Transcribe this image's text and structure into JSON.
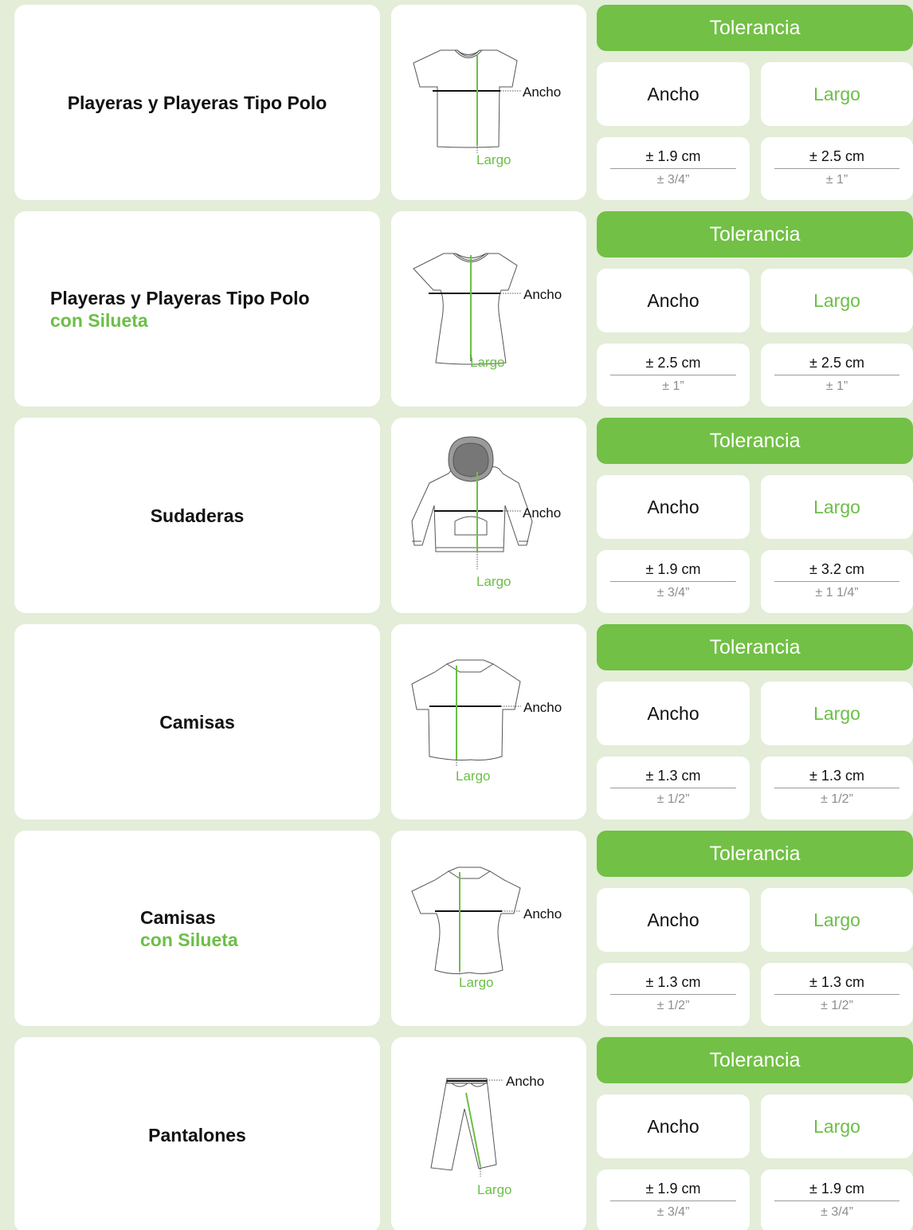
{
  "header_label": "Tolerancia",
  "col_ancho": "Ancho",
  "col_largo": "Largo",
  "accent_color": "#72c045",
  "background_color": "#e3edd8",
  "rows": [
    {
      "line1": "Playeras y Playeras Tipo Polo",
      "line2": "",
      "icon": "tshirt-icon",
      "diagram_ancho": "Ancho",
      "diagram_largo": "Largo",
      "ancho_cm": "± 1.9 cm",
      "ancho_in": "± 3/4”",
      "largo_cm": "± 2.5 cm",
      "largo_in": "± 1”"
    },
    {
      "line1": "Playeras y Playeras Tipo Polo",
      "line2": "con Silueta",
      "icon": "fitted-tshirt-icon",
      "diagram_ancho": "Ancho",
      "diagram_largo": "Largo",
      "ancho_cm": "± 2.5 cm",
      "ancho_in": "± 1”",
      "largo_cm": "± 2.5 cm",
      "largo_in": "± 1”"
    },
    {
      "line1": "Sudaderas",
      "line2": "",
      "icon": "hoodie-icon",
      "diagram_ancho": "Ancho",
      "diagram_largo": "Largo",
      "ancho_cm": "± 1.9 cm",
      "ancho_in": "± 3/4”",
      "largo_cm": "± 3.2 cm",
      "largo_in": "± 1 1/4”"
    },
    {
      "line1": "Camisas",
      "line2": "",
      "icon": "shirt-icon",
      "diagram_ancho": "Ancho",
      "diagram_largo": "Largo",
      "ancho_cm": "± 1.3 cm",
      "ancho_in": "± 1/2”",
      "largo_cm": "± 1.3 cm",
      "largo_in": "± 1/2”"
    },
    {
      "line1": "Camisas",
      "line2": "con Silueta",
      "icon": "fitted-shirt-icon",
      "diagram_ancho": "Ancho",
      "diagram_largo": "Largo",
      "ancho_cm": "± 1.3 cm",
      "ancho_in": "± 1/2”",
      "largo_cm": "± 1.3 cm",
      "largo_in": "± 1/2”"
    },
    {
      "line1": "Pantalones",
      "line2": "",
      "icon": "pants-icon",
      "diagram_ancho": "Ancho",
      "diagram_largo": "Largo",
      "ancho_cm": "± 1.9 cm",
      "ancho_in": "± 3/4”",
      "largo_cm": "± 1.9 cm",
      "largo_in": "± 3/4”"
    }
  ]
}
